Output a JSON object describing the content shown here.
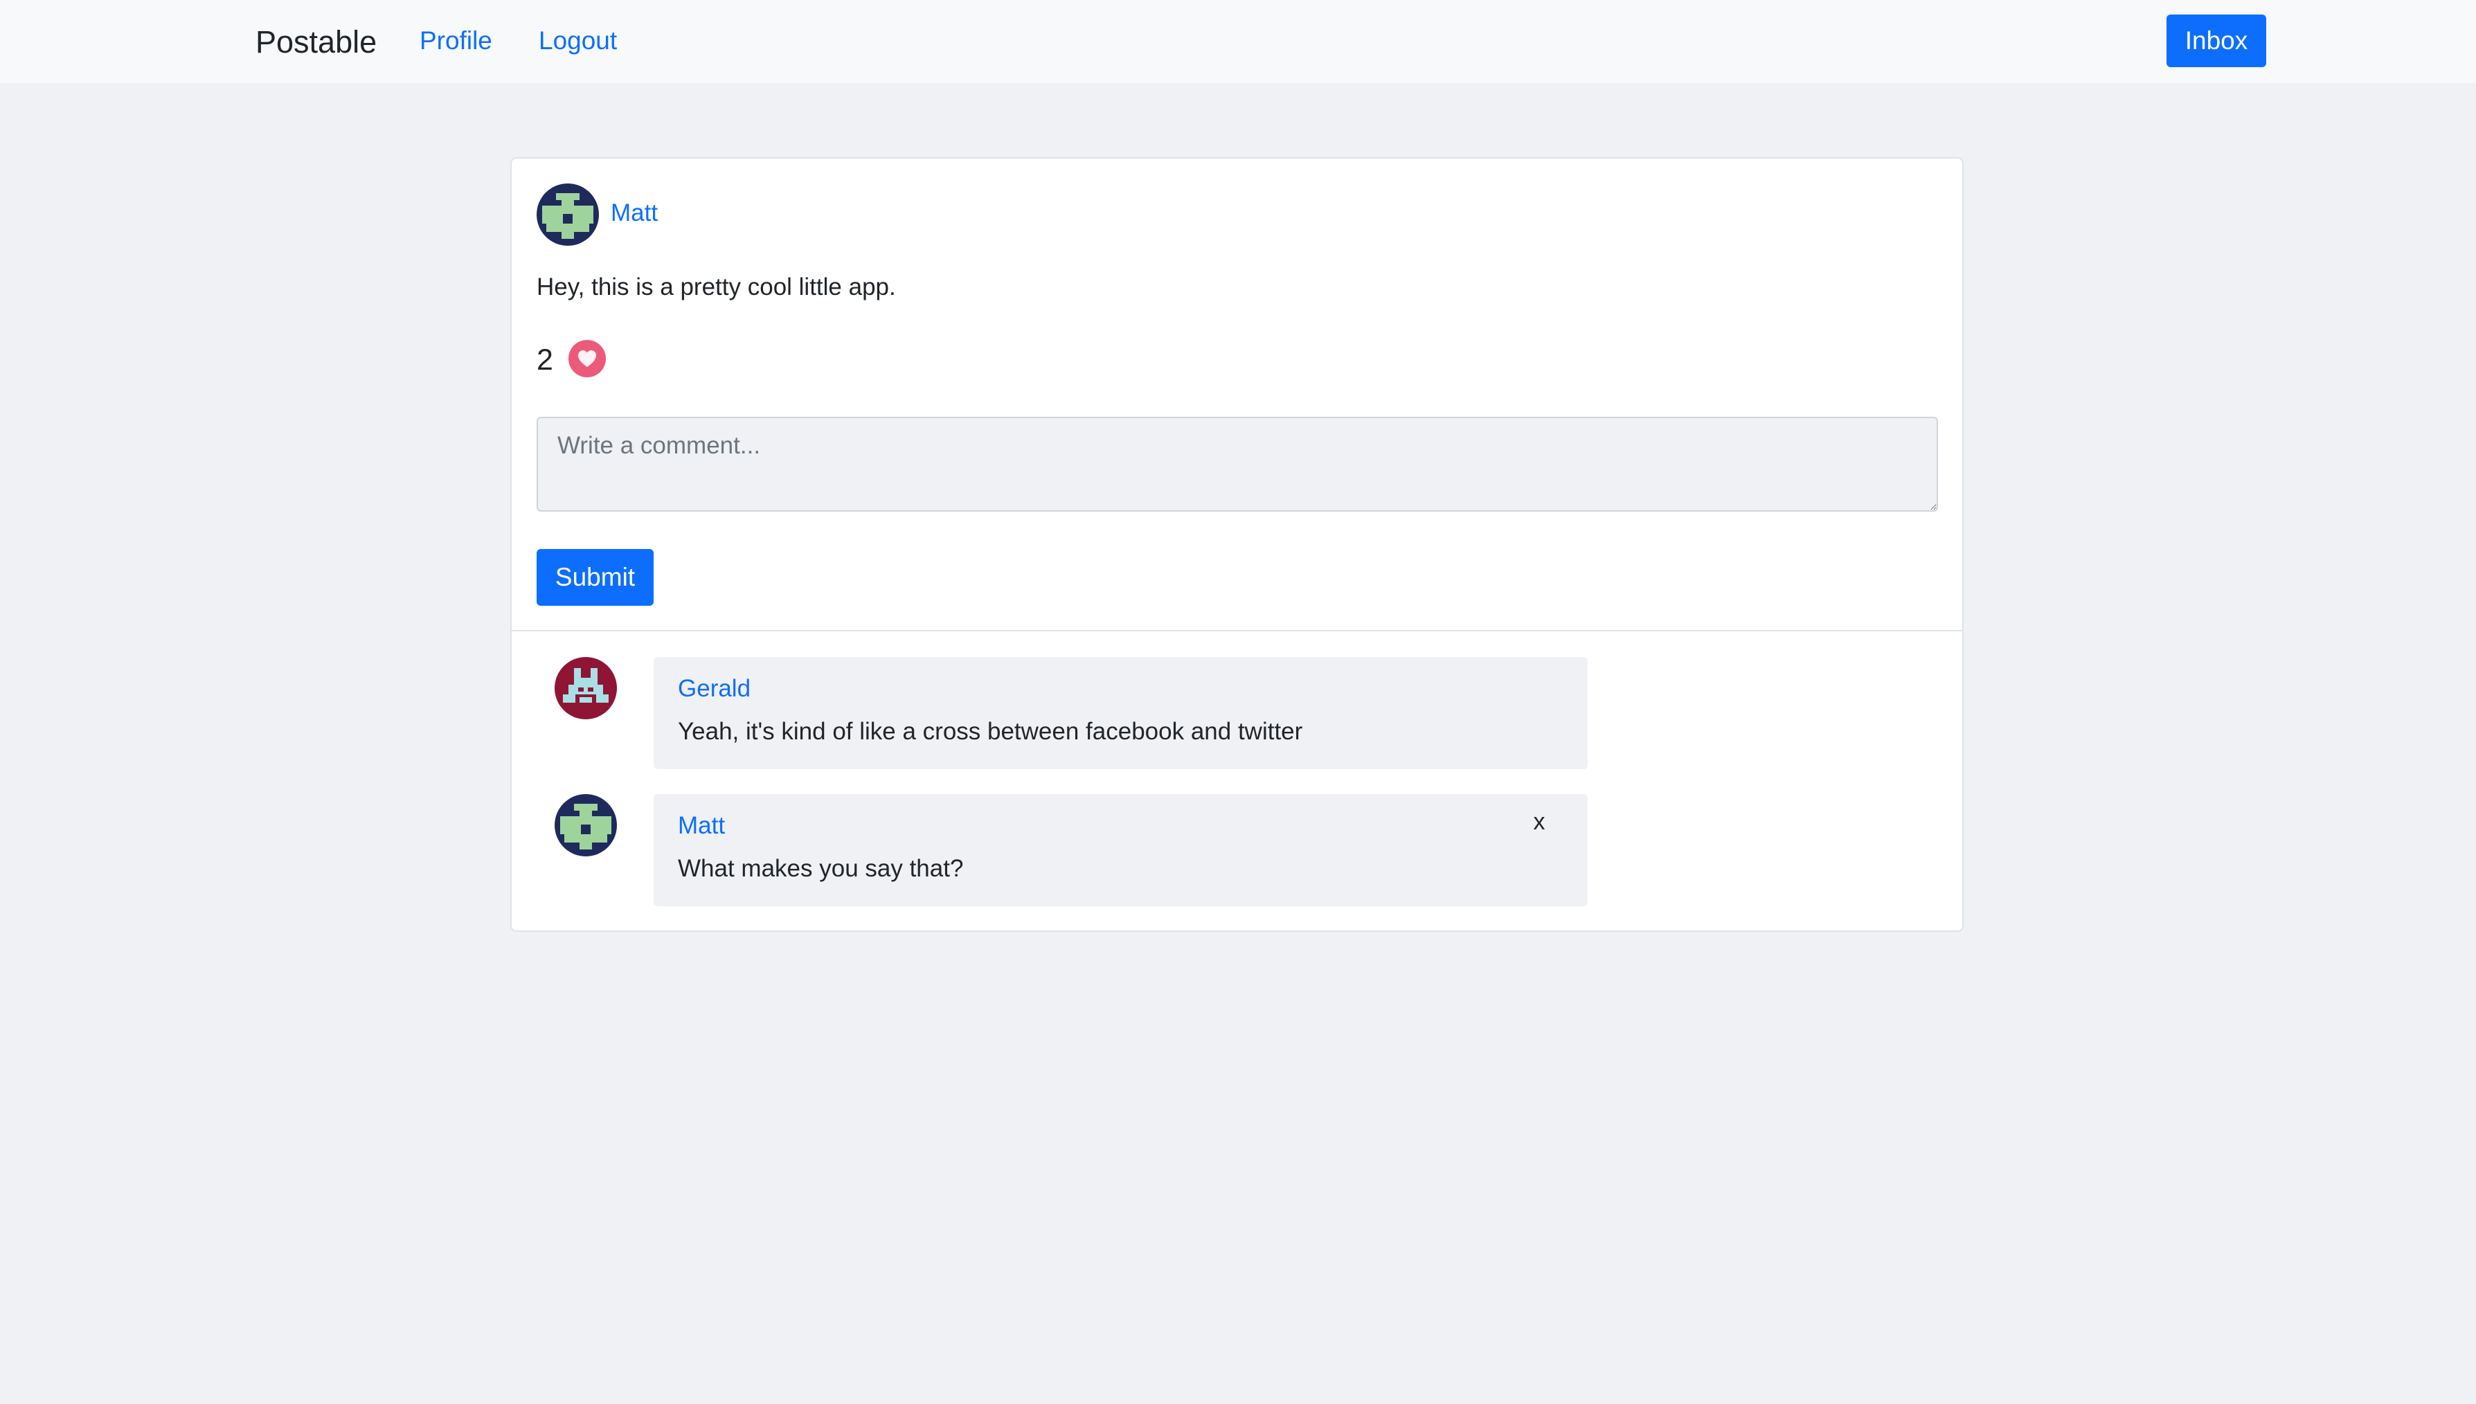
{
  "nav": {
    "brand": "Postable",
    "links": [
      "Profile",
      "Logout"
    ],
    "inbox_label": "Inbox"
  },
  "post": {
    "author": "Matt",
    "text": "Hey, this is a pretty cool little app.",
    "likes": "2",
    "comment_placeholder": "Write a comment...",
    "submit_label": "Submit"
  },
  "comments": [
    {
      "author": "Gerald",
      "text": "Yeah, it's kind of like a cross between facebook and twitter"
    },
    {
      "author": "Matt",
      "text": "What makes you say that?",
      "delete_label": "x"
    }
  ],
  "icons": {
    "like": "heart-icon",
    "avatars": [
      "pixel-avatar-navy-green",
      "pixel-avatar-crimson-teal"
    ]
  },
  "colors": {
    "accent": "#0d6efd",
    "page_background": "#f0f1f4",
    "navbar_background": "#f8f9fa",
    "heart": "#ec5a7a",
    "avatar_matt_bg": "#1f2a5c",
    "avatar_matt_fg": "#9fd39c",
    "avatar_gerald_bg": "#8f1535",
    "avatar_gerald_fg": "#a8e0e6"
  }
}
